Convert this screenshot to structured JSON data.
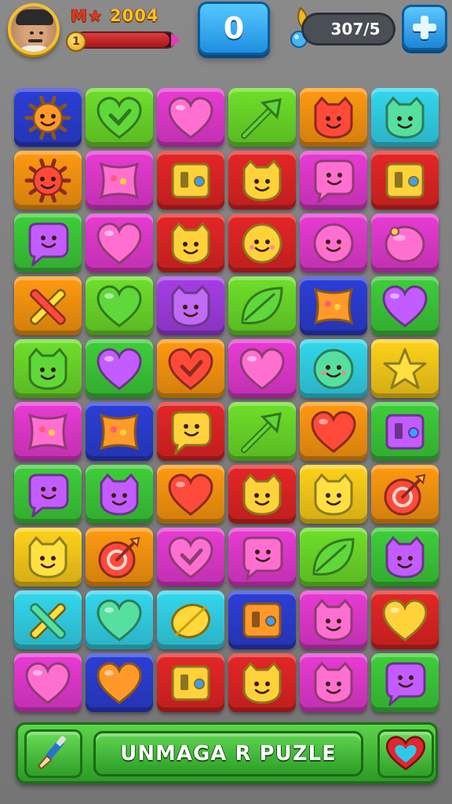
{
  "hud": {
    "level_prefix": "M★",
    "level_value": "2004",
    "level_badge": "1",
    "xp_progress": 0.95,
    "score": "0",
    "moves": "307/5"
  },
  "colors": {
    "blue": "#2c3fd8",
    "green": "#6ee02a",
    "magenta": "#e93bd5",
    "orange": "#ff9a10",
    "cyan": "#33d8ee",
    "red": "#e62626",
    "yellow": "#ffd21a",
    "purple": "#a63ee8",
    "lime": "#3ecf3a"
  },
  "board": {
    "rows": [
      [
        {
          "color": "blue",
          "icon": "sun-icon"
        },
        {
          "color": "green",
          "icon": "heart-outline-icon"
        },
        {
          "color": "magenta",
          "icon": "heart-icon"
        },
        {
          "color": "green",
          "icon": "arrow-icon"
        },
        {
          "color": "orange",
          "icon": "cat-icon"
        },
        {
          "color": "cyan",
          "icon": "cat-icon"
        }
      ],
      [
        {
          "color": "orange",
          "icon": "sun-icon"
        },
        {
          "color": "magenta",
          "icon": "pillow-icon"
        },
        {
          "color": "red",
          "icon": "box-icon"
        },
        {
          "color": "red",
          "icon": "cat-icon"
        },
        {
          "color": "magenta",
          "icon": "bubble-icon"
        },
        {
          "color": "red",
          "icon": "box-icon"
        }
      ],
      [
        {
          "color": "lime",
          "icon": "bubble-icon"
        },
        {
          "color": "magenta",
          "icon": "heart-icon"
        },
        {
          "color": "red",
          "icon": "cat-icon"
        },
        {
          "color": "red",
          "icon": "smiley-icon"
        },
        {
          "color": "magenta",
          "icon": "smiley-icon"
        },
        {
          "color": "magenta",
          "icon": "orb-icon"
        }
      ],
      [
        {
          "color": "orange",
          "icon": "cross-icon"
        },
        {
          "color": "green",
          "icon": "heart-icon"
        },
        {
          "color": "purple",
          "icon": "cat-icon"
        },
        {
          "color": "green",
          "icon": "leaf-icon"
        },
        {
          "color": "blue",
          "icon": "pillow-icon"
        },
        {
          "color": "lime",
          "icon": "heart-icon"
        }
      ],
      [
        {
          "color": "green",
          "icon": "cat-icon"
        },
        {
          "color": "lime",
          "icon": "heart-icon"
        },
        {
          "color": "orange",
          "icon": "heart-outline-icon"
        },
        {
          "color": "magenta",
          "icon": "heart-icon"
        },
        {
          "color": "cyan",
          "icon": "smiley-icon"
        },
        {
          "color": "yellow",
          "icon": "star-icon"
        }
      ],
      [
        {
          "color": "magenta",
          "icon": "pillow-icon"
        },
        {
          "color": "blue",
          "icon": "pillow-icon"
        },
        {
          "color": "red",
          "icon": "bubble-icon"
        },
        {
          "color": "green",
          "icon": "arrow-icon"
        },
        {
          "color": "orange",
          "icon": "heart-icon"
        },
        {
          "color": "lime",
          "icon": "box-icon"
        }
      ],
      [
        {
          "color": "lime",
          "icon": "bubble-icon"
        },
        {
          "color": "lime",
          "icon": "cat-icon"
        },
        {
          "color": "orange",
          "icon": "heart-icon"
        },
        {
          "color": "red",
          "icon": "cat-icon"
        },
        {
          "color": "yellow",
          "icon": "cat-icon"
        },
        {
          "color": "orange",
          "icon": "target-icon"
        }
      ],
      [
        {
          "color": "yellow",
          "icon": "cat-icon"
        },
        {
          "color": "orange",
          "icon": "target-icon"
        },
        {
          "color": "magenta",
          "icon": "heart-outline-icon"
        },
        {
          "color": "magenta",
          "icon": "bubble-icon"
        },
        {
          "color": "green",
          "icon": "leaf-icon"
        },
        {
          "color": "lime",
          "icon": "cat-icon"
        }
      ],
      [
        {
          "color": "cyan",
          "icon": "cross-icon"
        },
        {
          "color": "cyan",
          "icon": "heart-icon"
        },
        {
          "color": "cyan",
          "icon": "lemon-icon"
        },
        {
          "color": "blue",
          "icon": "box-icon"
        },
        {
          "color": "magenta",
          "icon": "cat-icon"
        },
        {
          "color": "red",
          "icon": "heart-icon"
        }
      ],
      [
        {
          "color": "magenta",
          "icon": "heart-icon"
        },
        {
          "color": "blue",
          "icon": "heart-icon"
        },
        {
          "color": "red",
          "icon": "box-icon"
        },
        {
          "color": "red",
          "icon": "cat-icon"
        },
        {
          "color": "magenta",
          "icon": "cat-icon"
        },
        {
          "color": "lime",
          "icon": "bubble-icon"
        }
      ]
    ]
  },
  "bottom_bar": {
    "title": "UNMAGA R PUZLE",
    "left_icon": "paintbrush-icon",
    "right_icon": "heart-icon"
  }
}
